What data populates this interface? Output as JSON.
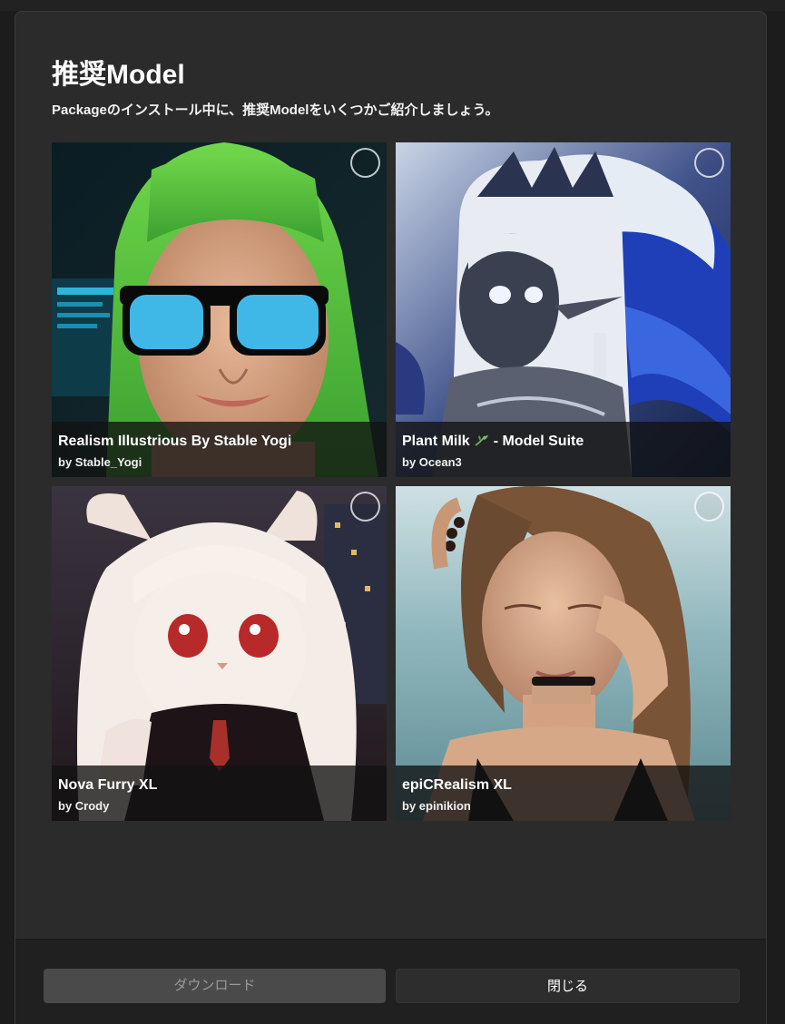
{
  "dialog": {
    "title": "推奨Model",
    "subtitle": "Packageのインストール中に、推奨Modelをいくつかご紹介しましょう。"
  },
  "models": [
    {
      "title": "Realism Illustrious By Stable Yogi",
      "author": "by Stable_Yogi",
      "selected": false
    },
    {
      "title_before": "Plant Milk",
      "title_after": "- Model Suite",
      "title_icon": "leaf-icon",
      "author": "by Ocean3",
      "selected": false
    },
    {
      "title": "Nova Furry XL",
      "author": "by Crody",
      "selected": false
    },
    {
      "title": "epiCRealism XL",
      "author": "by epinikion",
      "selected": false
    }
  ],
  "footer": {
    "download_label": "ダウンロード",
    "close_label": "閉じる"
  },
  "colors": {
    "dialog_bg": "#2b2b2b",
    "footer_bg": "#202020",
    "download_bg": "#4a4a4a",
    "close_bg": "#2d2d2d"
  }
}
